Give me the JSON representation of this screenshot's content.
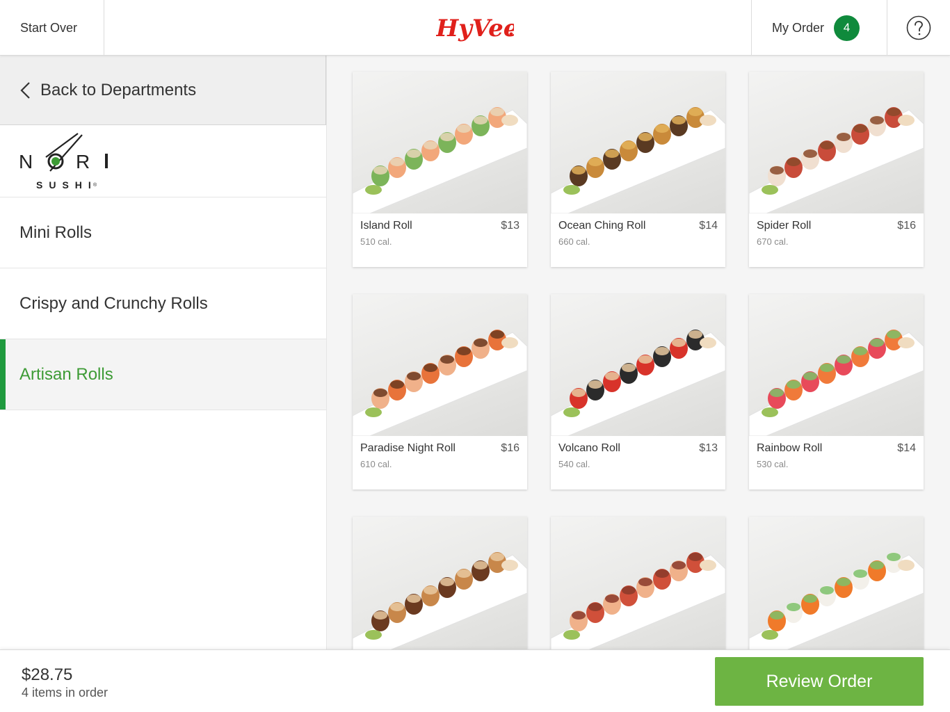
{
  "header": {
    "start_over": "Start Over",
    "logo_text": "HyVee",
    "my_order_label": "My Order",
    "order_count": "4",
    "help_icon": "question-circle-icon"
  },
  "sidebar": {
    "back_label": "Back to Departments",
    "brand_word": "NORI",
    "brand_sub": "SUSHI",
    "categories": [
      {
        "label": "Mini Rolls"
      },
      {
        "label": "Crispy and Crunchy Rolls"
      },
      {
        "label": "Artisan Rolls"
      }
    ]
  },
  "products": [
    {
      "name": "Island Roll",
      "price": "$13",
      "calories": "510 cal."
    },
    {
      "name": "Ocean Ching Roll",
      "price": "$14",
      "calories": "660 cal."
    },
    {
      "name": "Spider Roll",
      "price": "$16",
      "calories": "670 cal."
    },
    {
      "name": "Paradise Night Roll",
      "price": "$16",
      "calories": "610 cal."
    },
    {
      "name": "Volcano Roll",
      "price": "$13",
      "calories": "540 cal."
    },
    {
      "name": "Rainbow Roll",
      "price": "$14",
      "calories": "530 cal."
    },
    {
      "name": "",
      "price": "",
      "calories": ""
    },
    {
      "name": "",
      "price": "",
      "calories": ""
    },
    {
      "name": "",
      "price": "",
      "calories": ""
    }
  ],
  "footer": {
    "total": "$28.75",
    "items": "4 items in order",
    "review_button": "Review Order"
  },
  "colors": {
    "accent_green": "#6db443",
    "active_green": "#3d9b35",
    "badge_green": "#0f8a3c",
    "brand_red": "#e0201b"
  }
}
